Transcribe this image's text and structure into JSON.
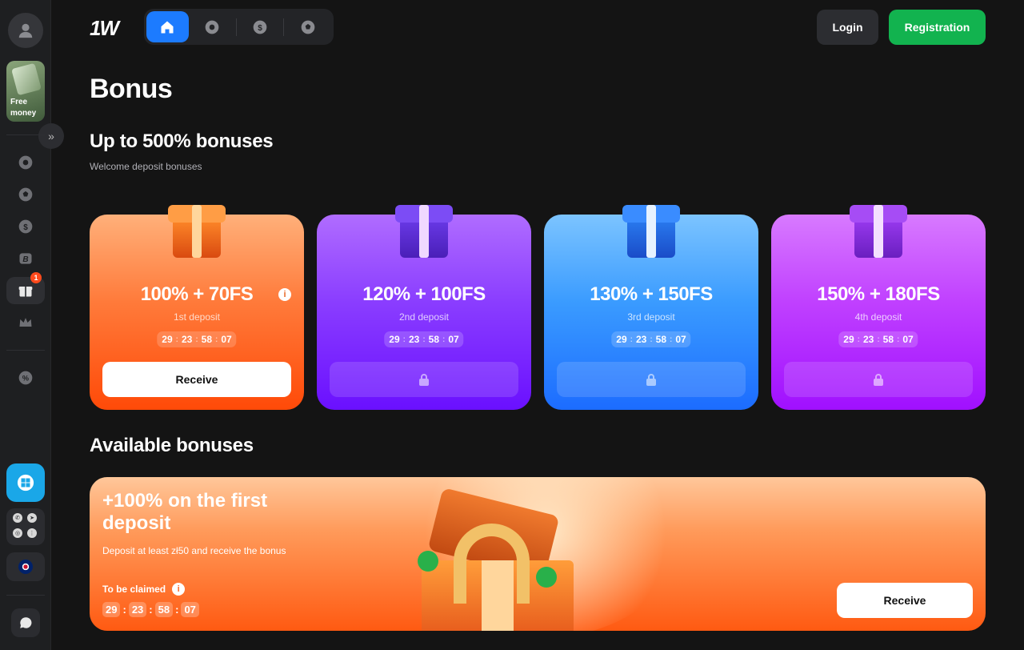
{
  "brand": {
    "logo_text": "1W"
  },
  "header": {
    "login_label": "Login",
    "register_label": "Registration"
  },
  "sidebar": {
    "free_money_label": "Free money",
    "notifications_badge": "1"
  },
  "page": {
    "title": "Bonus"
  },
  "welcome": {
    "title": "Up to 500% bonuses",
    "subtitle": "Welcome deposit bonuses",
    "cards": [
      {
        "offer": "100% + 70FS",
        "label": "1st deposit",
        "timer": [
          "29",
          "23",
          "58",
          "07"
        ],
        "button": "Receive",
        "locked": false
      },
      {
        "offer": "120% + 100FS",
        "label": "2nd deposit",
        "timer": [
          "29",
          "23",
          "58",
          "07"
        ],
        "locked": true
      },
      {
        "offer": "130% + 150FS",
        "label": "3rd deposit",
        "timer": [
          "29",
          "23",
          "58",
          "07"
        ],
        "locked": true
      },
      {
        "offer": "150% + 180FS",
        "label": "4th deposit",
        "timer": [
          "29",
          "23",
          "58",
          "07"
        ],
        "locked": true
      }
    ]
  },
  "available": {
    "title": "Available bonuses",
    "banner": {
      "title": "+100% on the first deposit",
      "description": "Deposit at least zł50 and receive the bonus",
      "claim_label": "To be claimed",
      "timer": [
        "29",
        "23",
        "58",
        "07"
      ],
      "button": "Receive"
    }
  },
  "colors": {
    "accent_blue": "#1c7bff",
    "register_green": "#12b34f",
    "card1": "#ff6a1e",
    "card2": "#7a2cff",
    "card3": "#1c8bff",
    "card4": "#b320ff"
  }
}
